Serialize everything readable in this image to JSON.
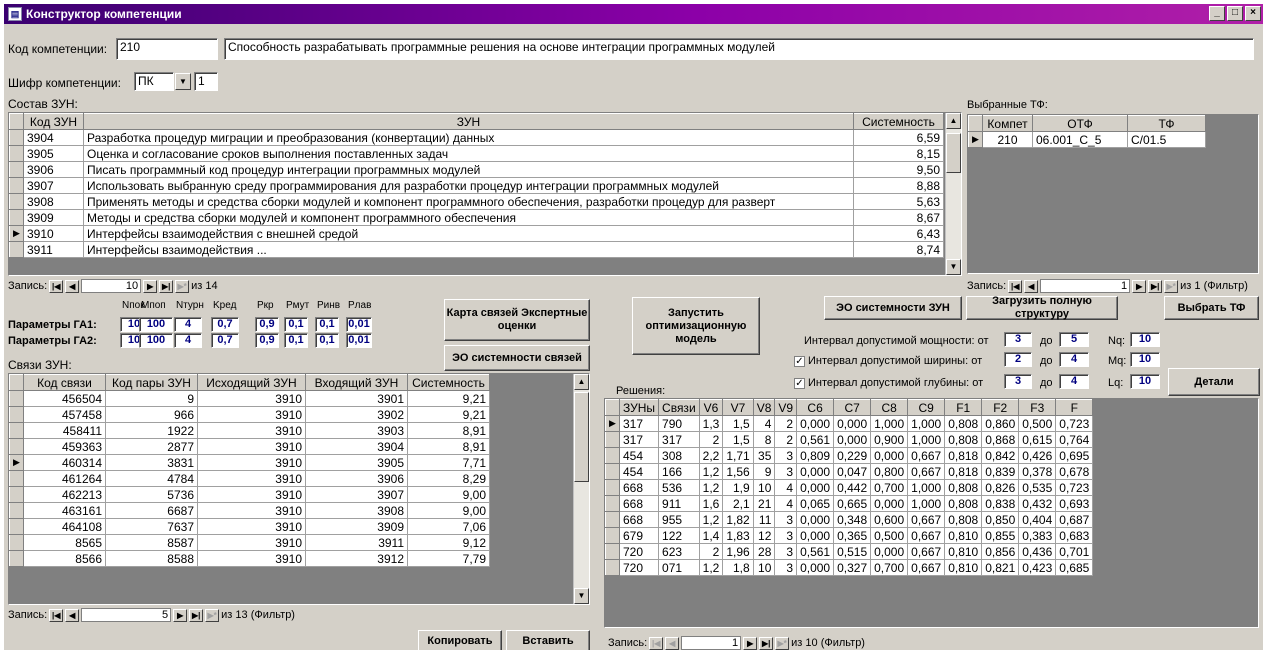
{
  "window": {
    "title": "Конструктор компетенции"
  },
  "header": {
    "code_label": "Код компетенции:",
    "code_value": "210",
    "description": "Способность разрабатывать программные решения на основе интеграции программных модулей",
    "cipher_label": "Шифр компетенции:",
    "cipher_value": "ПК",
    "cipher_num": "1"
  },
  "zun": {
    "section_label": "Состав ЗУН:",
    "columns": [
      "Код ЗУН",
      "ЗУН",
      "Системность"
    ],
    "rows": [
      [
        "3904",
        "Разработка процедур миграции и преобразования (конвертации) данных",
        "6,59"
      ],
      [
        "3905",
        "Оценка и согласование сроков выполнения поставленных задач",
        "8,15"
      ],
      [
        "3906",
        "Писать программный код процедур интеграции программных модулей",
        "9,50"
      ],
      [
        "3907",
        "Использовать выбранную среду программирования для разработки процедур интеграции программных модулей",
        "8,88"
      ],
      [
        "3908",
        "Применять методы и средства сборки модулей и компонент программного обеспечения, разработки процедур для разверт",
        "5,63"
      ],
      [
        "3909",
        "Методы и средства сборки модулей и компонент программного обеспечения",
        "8,67"
      ],
      [
        "3910",
        "Интерфейсы взаимодействия с внешней средой",
        "6,43"
      ],
      [
        "3911",
        "Интерфейсы взаимодействия ...",
        "8,74"
      ]
    ],
    "nav_label": "Запись:",
    "nav_current": "10",
    "nav_total": "из 14"
  },
  "tf": {
    "section_label": "Выбранные ТФ:",
    "columns": [
      "Компет",
      "ОТФ",
      "ТФ"
    ],
    "rows": [
      [
        "210",
        "06.001_C_5",
        "C/01.5"
      ]
    ],
    "nav_label": "Запись:",
    "nav_current": "1",
    "nav_total": "из 1 (Фильтр)"
  },
  "params": {
    "headers": [
      "Nпок",
      "Mпоп",
      "Nтурн",
      "Kред",
      "Pкр",
      "Pмут",
      "Pинв",
      "Pлав"
    ],
    "ga1_label": "Параметры ГА1:",
    "ga1": [
      "10",
      "100",
      "4",
      "0,7",
      "0,9",
      "0,1",
      "0,1",
      "0,01"
    ],
    "ga2_label": "Параметры ГА2:",
    "ga2": [
      "10",
      "100",
      "4",
      "0,7",
      "0,9",
      "0,1",
      "0,1",
      "0,01"
    ]
  },
  "buttons": {
    "map": "Карта связей Экспертные оценки",
    "eo_links": "ЭО системности связей",
    "run": "Запустить оптимизационную модель",
    "eo_zun": "ЭО системности ЗУН",
    "load": "Загрузить полную структуру",
    "choose_tf": "Выбрать ТФ",
    "details": "Детали",
    "copy": "Копировать",
    "paste": "Вставить"
  },
  "intervals": {
    "power_label": "Интервал допустимой мощности: от",
    "power_from": "3",
    "power_to": "5",
    "width_label": "Интервал допустимой ширины: от",
    "width_from": "2",
    "width_to": "4",
    "depth_label": "Интервал допустимой глубины: от",
    "depth_from": "3",
    "depth_to": "4",
    "to_label": "до",
    "nq_label": "Nq:",
    "nq": "10",
    "mq_label": "Mq:",
    "mq": "10",
    "lq_label": "Lq:",
    "lq": "10"
  },
  "links": {
    "section_label": "Связи ЗУН:",
    "columns": [
      "Код связи",
      "Код пары ЗУН",
      "Исходящий ЗУН",
      "Входящий ЗУН",
      "Системность"
    ],
    "rows": [
      [
        "456504",
        "9",
        "3910",
        "3901",
        "9,21"
      ],
      [
        "457458",
        "966",
        "3910",
        "3902",
        "9,21"
      ],
      [
        "458411",
        "1922",
        "3910",
        "3903",
        "8,91"
      ],
      [
        "459363",
        "2877",
        "3910",
        "3904",
        "8,91"
      ],
      [
        "460314",
        "3831",
        "3910",
        "3905",
        "7,71"
      ],
      [
        "461264",
        "4784",
        "3910",
        "3906",
        "8,29"
      ],
      [
        "462213",
        "5736",
        "3910",
        "3907",
        "9,00"
      ],
      [
        "463161",
        "6687",
        "3910",
        "3908",
        "9,00"
      ],
      [
        "464108",
        "7637",
        "3910",
        "3909",
        "7,06"
      ],
      [
        "8565",
        "8587",
        "3910",
        "3911",
        "9,12"
      ],
      [
        "8566",
        "8588",
        "3910",
        "3912",
        "7,79"
      ]
    ],
    "nav_label": "Запись:",
    "nav_current": "5",
    "nav_total": "из 13 (Фильтр)"
  },
  "solutions": {
    "section_label": "Решения:",
    "columns": [
      "ЗУНы",
      "Связи",
      "V6",
      "V7",
      "V8",
      "V9",
      "C6",
      "C7",
      "C8",
      "C9",
      "F1",
      "F2",
      "F3",
      "F"
    ],
    "rows": [
      [
        "317",
        "790",
        "1,3",
        "1,5",
        "4",
        "2",
        "0,000",
        "0,000",
        "1,000",
        "1,000",
        "0,808",
        "0,860",
        "0,500",
        "0,723"
      ],
      [
        "317",
        "317",
        "2",
        "1,5",
        "8",
        "2",
        "0,561",
        "0,000",
        "0,900",
        "1,000",
        "0,808",
        "0,868",
        "0,615",
        "0,764"
      ],
      [
        "454",
        "308",
        "2,2",
        "1,71",
        "35",
        "3",
        "0,809",
        "0,229",
        "0,000",
        "0,667",
        "0,818",
        "0,842",
        "0,426",
        "0,695"
      ],
      [
        "454",
        "166",
        "1,2",
        "1,56",
        "9",
        "3",
        "0,000",
        "0,047",
        "0,800",
        "0,667",
        "0,818",
        "0,839",
        "0,378",
        "0,678"
      ],
      [
        "668",
        "536",
        "1,2",
        "1,9",
        "10",
        "4",
        "0,000",
        "0,442",
        "0,700",
        "1,000",
        "0,808",
        "0,826",
        "0,535",
        "0,723"
      ],
      [
        "668",
        "911",
        "1,6",
        "2,1",
        "21",
        "4",
        "0,065",
        "0,665",
        "0,000",
        "1,000",
        "0,808",
        "0,838",
        "0,432",
        "0,693"
      ],
      [
        "668",
        "955",
        "1,2",
        "1,82",
        "11",
        "3",
        "0,000",
        "0,348",
        "0,600",
        "0,667",
        "0,808",
        "0,850",
        "0,404",
        "0,687"
      ],
      [
        "679",
        "122",
        "1,4",
        "1,83",
        "12",
        "3",
        "0,000",
        "0,365",
        "0,500",
        "0,667",
        "0,810",
        "0,855",
        "0,383",
        "0,683"
      ],
      [
        "720",
        "623",
        "2",
        "1,96",
        "28",
        "3",
        "0,561",
        "0,515",
        "0,000",
        "0,667",
        "0,810",
        "0,856",
        "0,436",
        "0,701"
      ],
      [
        "720",
        "071",
        "1,2",
        "1,8",
        "10",
        "3",
        "0,000",
        "0,327",
        "0,700",
        "0,667",
        "0,810",
        "0,821",
        "0,423",
        "0,685"
      ]
    ],
    "nav_label": "Запись:",
    "nav_current": "1",
    "nav_total": "из 10 (Фильтр)"
  }
}
